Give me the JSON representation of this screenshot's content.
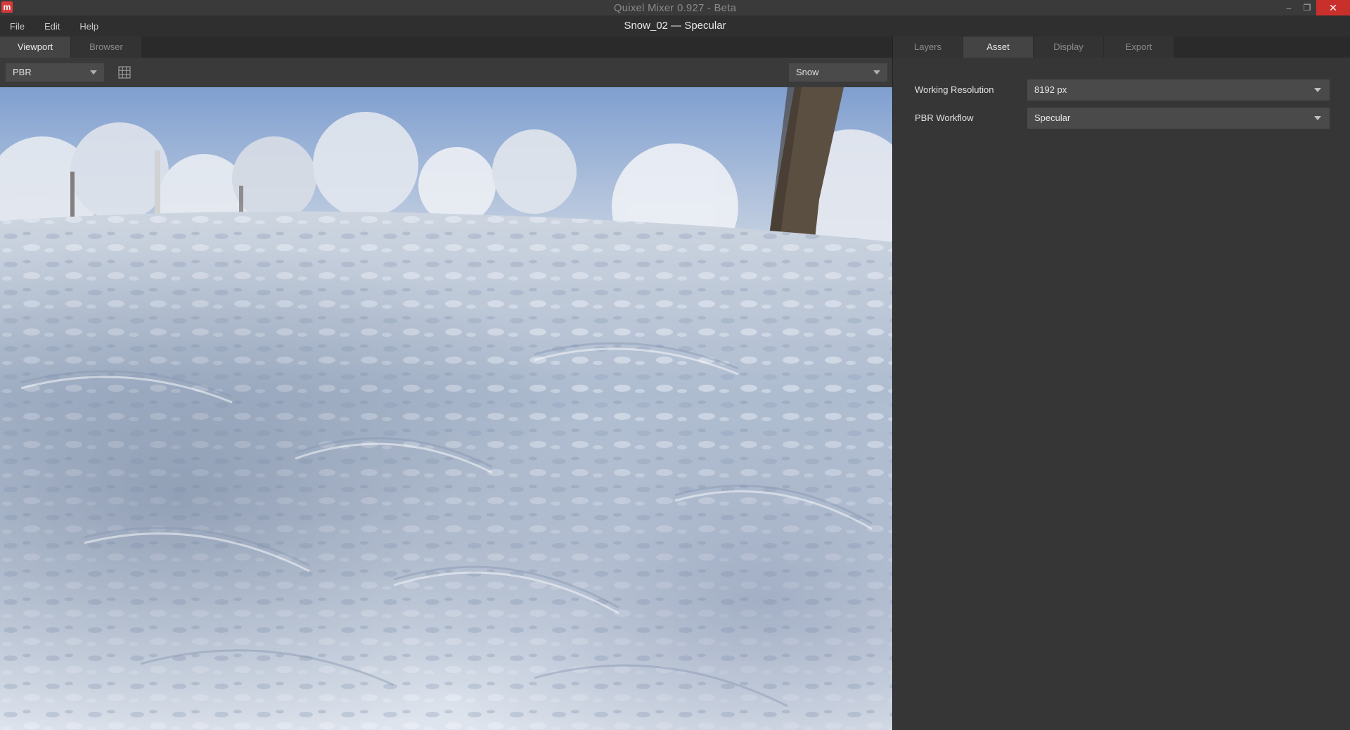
{
  "window": {
    "title": "Quixel Mixer 0.927 - Beta",
    "minimize_glyph": "–",
    "restore_glyph": "❐",
    "close_glyph": "✕"
  },
  "menu": {
    "items": [
      "File",
      "Edit",
      "Help"
    ],
    "document_title": "Snow_02 — Specular"
  },
  "left_tabs": [
    {
      "label": "Viewport",
      "active": true
    },
    {
      "label": "Browser",
      "active": false
    }
  ],
  "viewport_toolbar": {
    "render_mode": "PBR",
    "environment": "Snow",
    "grid_icon": "grid-icon"
  },
  "right_tabs": [
    {
      "label": "Layers",
      "active": false
    },
    {
      "label": "Asset",
      "active": true
    },
    {
      "label": "Display",
      "active": false
    },
    {
      "label": "Export",
      "active": false
    }
  ],
  "asset_properties": [
    {
      "label": "Working Resolution",
      "value": "8192 px"
    },
    {
      "label": "PBR Workflow",
      "value": "Specular"
    }
  ],
  "colors": {
    "accent_close": "#c9302c",
    "logo": "#d83b3b",
    "panel": "#363636"
  }
}
